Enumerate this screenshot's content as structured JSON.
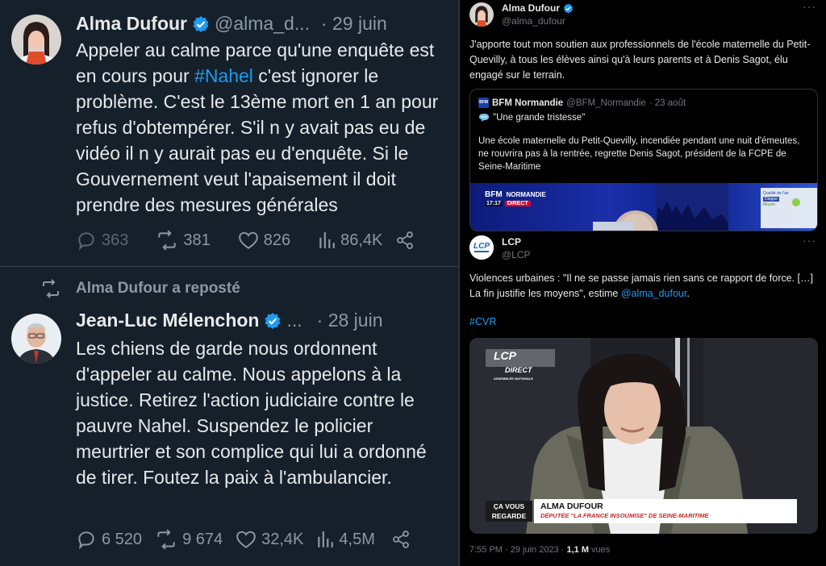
{
  "left": {
    "tweet1": {
      "name": "Alma Dufour",
      "handle": "@alma_d...",
      "date": "· 29 juin",
      "text_before": "Appeler au calme parce qu'une enquête est en cours pour ",
      "hashtag": "#Nahel",
      "text_after": " c'est ignorer le problème. C'est le 13ème mort en 1 an pour refus d'obtempérer. S'il n y avait pas eu de vidéo il n y aurait pas eu d'enquête. Si le Gouvernement veut l'apaisement il doit prendre des mesures générales",
      "replies": "363",
      "reposts": "381",
      "likes": "826",
      "views": "86,4K"
    },
    "repost_label": "Alma Dufour a reposté",
    "tweet2": {
      "name": "Jean-Luc Mélenchon",
      "handle": "...",
      "date": "· 28 juin",
      "text": "Les chiens de garde nous ordonnent d'appeler au calme. Nous appelons à la justice. Retirez l'action judiciaire contre le pauvre Nahel. Suspendez le policier meurtrier et son complice qui lui a ordonné de tirer. Foutez la paix à l'ambulancier.",
      "replies": "6 520",
      "reposts": "9 674",
      "likes": "32,4K",
      "views": "4,5M"
    }
  },
  "right": {
    "author": {
      "name": "Alma Dufour",
      "handle": "@alma_dufour"
    },
    "more": "···",
    "text": "J'apporte tout mon soutien aux professionnels de l'école maternelle du Petit-Quevilly, à tous les élèves ainsi qu'à leurs parents et à Denis Sagot, élu engagé sur le terrain.",
    "quote1": {
      "logo_text": "BFM",
      "name": "BFM Normandie",
      "handle": "@BFM_Normandie",
      "date": "· 23 août",
      "line1": "\"Une grande tristesse\"",
      "body": "Une école maternelle du Petit-Quevilly, incendiée pendant une nuit d'émeutes, ne rouvrira pas à la rentrée, regrette Denis Sagot, président de la FCPE de Seine-Maritime",
      "banner_bfm": "BFM",
      "banner_region": "NORMANDIE",
      "banner_time": "17:17",
      "banner_direct": "DIRECT",
      "weather_label": "Qualité de l'air",
      "weather_city": "Dieppe",
      "weather_status": "Moyen"
    },
    "quote2": {
      "name": "LCP",
      "handle": "@LCP",
      "logo_text": "LCP",
      "text_1": "Violences urbaines : \"Il ne se passe jamais rien sans ce rapport de force. […] La fin justifie les moyens\", estime ",
      "mention": "@alma_dufour",
      "text_2": ".",
      "hashtag": "#CVR",
      "video_logo": "LCP",
      "video_logo_sub": "ASSEMBLÉE NATIONALE",
      "video_direct": "DIRECT",
      "lower_show_1": "ÇA VOUS",
      "lower_show_2": "REGARDE",
      "lower_name": "ALMA DUFOUR",
      "lower_title": "DÉPUTÉE \"LA FRANCE INSOUMISE\" DE SEINE-MARITIME"
    },
    "footer": {
      "time": "7:55 PM · 29 juin 2023 · ",
      "views_count": "1,1 M",
      "views_label": " vues"
    }
  },
  "colors": {
    "accent": "#1d9bf0",
    "dim_bg": "#15202b",
    "black_bg": "#000000",
    "lcp_blue": "#1565c0"
  }
}
